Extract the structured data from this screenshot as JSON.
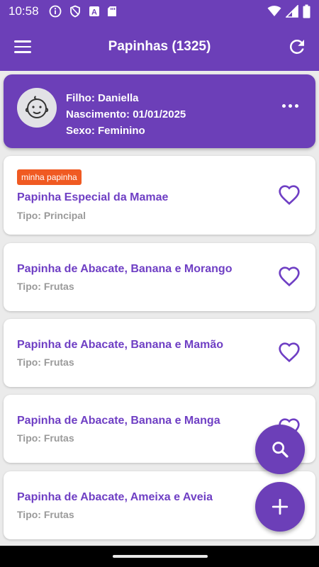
{
  "status_bar": {
    "time": "10:58",
    "left_icons": [
      "info-icon",
      "shield-icon",
      "font-a-icon",
      "sd-card-icon"
    ],
    "right_icons": [
      "wifi-icon",
      "signal-icon",
      "battery-icon"
    ]
  },
  "app_bar": {
    "title": "Papinhas (1325)",
    "menu_icon": "hamburger-menu-icon",
    "refresh_icon": "refresh-icon"
  },
  "child": {
    "name_line": "Filho: Daniella",
    "birth_line": "Nascimento: 01/01/2025",
    "sex_line": "Sexo: Feminino",
    "avatar_icon": "baby-face-icon",
    "more_icon": "more-horizontal-icon"
  },
  "recipes": [
    {
      "badge": "minha papinha",
      "name": "Papinha Especial da Mamae",
      "type": "Tipo: Principal"
    },
    {
      "name": "Papinha de Abacate, Banana e Morango",
      "type": "Tipo: Frutas"
    },
    {
      "name": "Papinha de Abacate, Banana e Mamão",
      "type": "Tipo: Frutas"
    },
    {
      "name": "Papinha de Abacate, Banana e Manga",
      "type": "Tipo: Frutas"
    },
    {
      "name": "Papinha de Abacate, Ameixa e Aveia",
      "type": "Tipo: Frutas"
    }
  ],
  "fabs": {
    "search_icon": "search-icon",
    "add_icon": "plus-icon"
  },
  "colors": {
    "primary": "#6c3fb8",
    "badge": "#f05a22",
    "recipe_name": "#6f3fc4",
    "secondary_text": "#9a9a9a",
    "background": "#ebebeb"
  }
}
